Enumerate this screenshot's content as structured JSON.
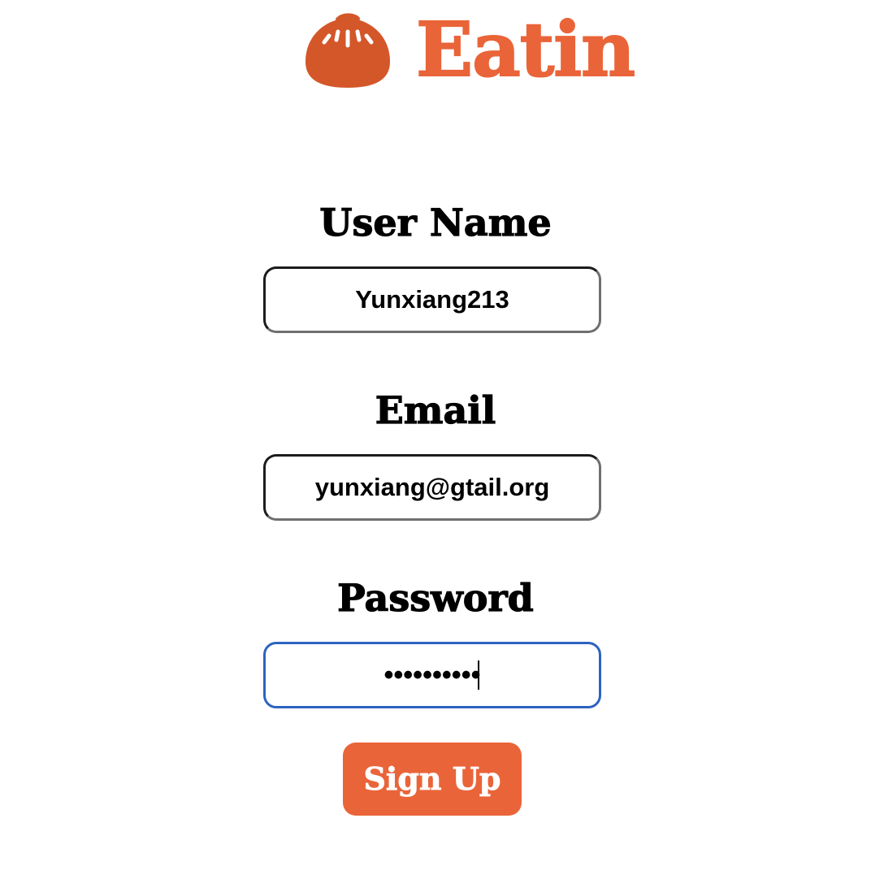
{
  "brand": {
    "name": "Eatin",
    "logo_icon": "steamed-bun-icon",
    "color": "#ea6439",
    "icon_color": "#d4572a"
  },
  "form": {
    "username_label": "User Name",
    "username_value": "Yunxiang213",
    "email_label": "Email",
    "email_value": "yunxiang@gtail.org",
    "password_label": "Password",
    "password_value": "••••••••••",
    "password_focused": true,
    "focus_color": "#2c63c0",
    "submit_label": "Sign Up"
  }
}
